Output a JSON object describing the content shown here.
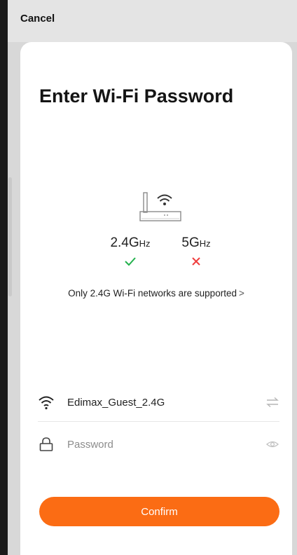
{
  "header": {
    "cancel_label": "Cancel"
  },
  "page": {
    "title": "Enter Wi-Fi Password"
  },
  "bands": {
    "b24": {
      "value": "2.4G",
      "unit": "Hz",
      "status": "supported"
    },
    "b5": {
      "value": "5G",
      "unit": "Hz",
      "status": "unsupported"
    }
  },
  "note": {
    "text": "Only 2.4G Wi-Fi networks are supported",
    "chevron": ">"
  },
  "ssid": {
    "value": "Edimax_Guest_2.4G"
  },
  "password": {
    "placeholder": "Password",
    "value": ""
  },
  "confirm": {
    "label": "Confirm"
  },
  "colors": {
    "accent": "#fb6c14",
    "check": "#23b14d",
    "cross": "#ef3d3d"
  },
  "icons": {
    "router": "router-icon",
    "check": "check-icon",
    "cross": "cross-icon",
    "wifi": "wifi-icon",
    "lock": "lock-icon",
    "switch": "switch-network-icon",
    "eye": "eye-icon"
  }
}
